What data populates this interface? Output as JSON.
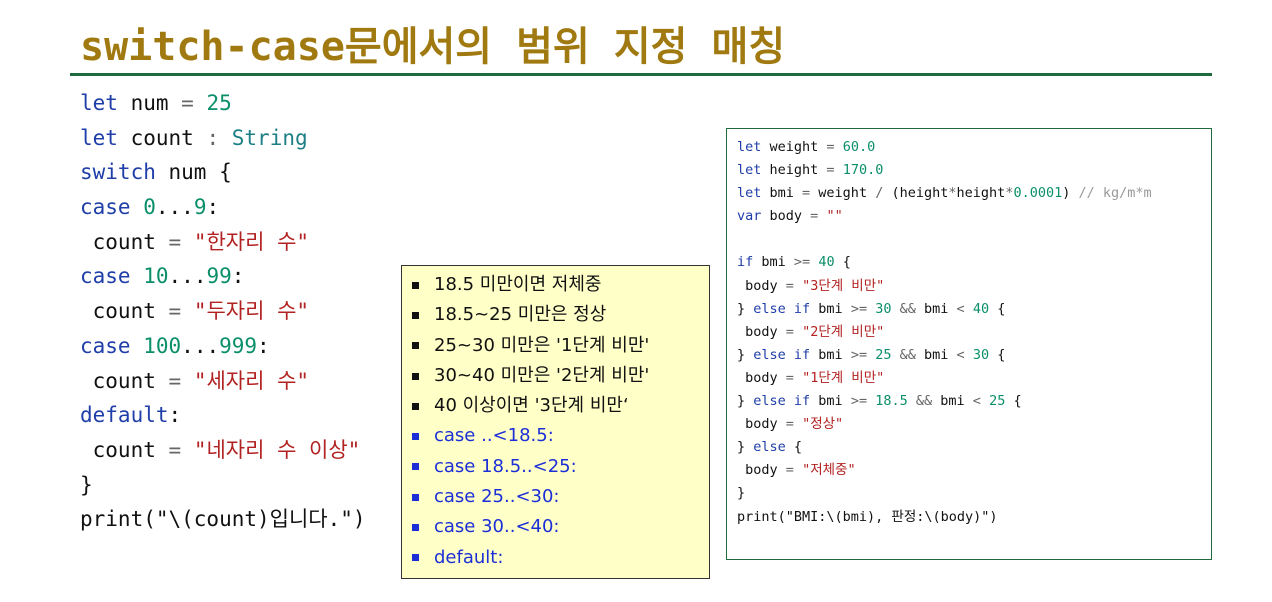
{
  "title": "switch-case문에서의 범위 지정 매칭",
  "main_code": [
    [
      {
        "t": "let",
        "c": "kw"
      },
      {
        "t": " num "
      },
      {
        "t": "=",
        "c": "op"
      },
      {
        "t": " "
      },
      {
        "t": "25",
        "c": "num"
      }
    ],
    [
      {
        "t": "let",
        "c": "kw"
      },
      {
        "t": " count "
      },
      {
        "t": ":",
        "c": "op"
      },
      {
        "t": " "
      },
      {
        "t": "String",
        "c": "type"
      }
    ],
    [
      {
        "t": "switch",
        "c": "kw"
      },
      {
        "t": " num {"
      }
    ],
    [
      {
        "t": "case",
        "c": "kw"
      },
      {
        "t": " "
      },
      {
        "t": "0",
        "c": "num"
      },
      {
        "t": "..."
      },
      {
        "t": "9",
        "c": "num"
      },
      {
        "t": ":"
      }
    ],
    [
      {
        "t": " count "
      },
      {
        "t": "=",
        "c": "op"
      },
      {
        "t": " "
      },
      {
        "t": "\"한자리 수\"",
        "c": "str"
      }
    ],
    [
      {
        "t": "case",
        "c": "kw"
      },
      {
        "t": " "
      },
      {
        "t": "10",
        "c": "num"
      },
      {
        "t": "..."
      },
      {
        "t": "99",
        "c": "num"
      },
      {
        "t": ":"
      }
    ],
    [
      {
        "t": " count "
      },
      {
        "t": "=",
        "c": "op"
      },
      {
        "t": " "
      },
      {
        "t": "\"두자리 수\"",
        "c": "str"
      }
    ],
    [
      {
        "t": "case",
        "c": "kw"
      },
      {
        "t": " "
      },
      {
        "t": "100",
        "c": "num"
      },
      {
        "t": "..."
      },
      {
        "t": "999",
        "c": "num"
      },
      {
        "t": ":"
      }
    ],
    [
      {
        "t": " count "
      },
      {
        "t": "=",
        "c": "op"
      },
      {
        "t": " "
      },
      {
        "t": "\"세자리 수\"",
        "c": "str"
      }
    ],
    [
      {
        "t": "default",
        "c": "kw"
      },
      {
        "t": ":"
      }
    ],
    [
      {
        "t": " count "
      },
      {
        "t": "=",
        "c": "op"
      },
      {
        "t": " "
      },
      {
        "t": "\"네자리 수 이상\"",
        "c": "str"
      }
    ],
    [
      {
        "t": "}"
      }
    ],
    [
      {
        "t": "print(\"\\(count)입니다.\")"
      }
    ]
  ],
  "note_items": [
    {
      "text": "18.5 미만이면 저체중",
      "color": "black"
    },
    {
      "text": "18.5~25 미만은 정상",
      "color": "black"
    },
    {
      "text": "25~30 미만은 '1단계 비만'",
      "color": "black"
    },
    {
      "text": "30~40 미만은 '2단계 비만'",
      "color": "black"
    },
    {
      "text": "40 이상이면 '3단계 비만‘",
      "color": "black"
    },
    {
      "text": "case ..<18.5:",
      "color": "blue"
    },
    {
      "text": "case 18.5..<25:",
      "color": "blue"
    },
    {
      "text": "case 25..<30:",
      "color": "blue"
    },
    {
      "text": "case 30..<40:",
      "color": "blue"
    },
    {
      "text": "default:",
      "color": "blue"
    }
  ],
  "box_code": [
    [
      {
        "t": "let",
        "c": "kw"
      },
      {
        "t": " weight "
      },
      {
        "t": "=",
        "c": "op"
      },
      {
        "t": " "
      },
      {
        "t": "60.0",
        "c": "num"
      }
    ],
    [
      {
        "t": "let",
        "c": "kw"
      },
      {
        "t": " height "
      },
      {
        "t": "=",
        "c": "op"
      },
      {
        "t": " "
      },
      {
        "t": "170.0",
        "c": "num"
      }
    ],
    [
      {
        "t": "let",
        "c": "kw"
      },
      {
        "t": " bmi "
      },
      {
        "t": "=",
        "c": "op"
      },
      {
        "t": " weight "
      },
      {
        "t": "/",
        "c": "op"
      },
      {
        "t": " (height"
      },
      {
        "t": "*",
        "c": "op"
      },
      {
        "t": "height"
      },
      {
        "t": "*",
        "c": "op"
      },
      {
        "t": "0.0001",
        "c": "num"
      },
      {
        "t": ") "
      },
      {
        "t": "// kg/m*m",
        "c": "cmt"
      }
    ],
    [
      {
        "t": "var",
        "c": "kw"
      },
      {
        "t": " body "
      },
      {
        "t": "=",
        "c": "op"
      },
      {
        "t": " "
      },
      {
        "t": "\"\"",
        "c": "str"
      }
    ],
    [
      {
        "t": ""
      }
    ],
    [
      {
        "t": "if",
        "c": "kw"
      },
      {
        "t": " bmi "
      },
      {
        "t": ">=",
        "c": "op"
      },
      {
        "t": " "
      },
      {
        "t": "40",
        "c": "num"
      },
      {
        "t": " {"
      }
    ],
    [
      {
        "t": " body "
      },
      {
        "t": "=",
        "c": "op"
      },
      {
        "t": " "
      },
      {
        "t": "\"3단계 비만\"",
        "c": "str"
      }
    ],
    [
      {
        "t": "} "
      },
      {
        "t": "else if",
        "c": "kw"
      },
      {
        "t": " bmi "
      },
      {
        "t": ">=",
        "c": "op"
      },
      {
        "t": " "
      },
      {
        "t": "30",
        "c": "num"
      },
      {
        "t": " "
      },
      {
        "t": "&&",
        "c": "op"
      },
      {
        "t": " bmi "
      },
      {
        "t": "<",
        "c": "op"
      },
      {
        "t": " "
      },
      {
        "t": "40",
        "c": "num"
      },
      {
        "t": " {"
      }
    ],
    [
      {
        "t": " body "
      },
      {
        "t": "=",
        "c": "op"
      },
      {
        "t": " "
      },
      {
        "t": "\"2단계 비만\"",
        "c": "str"
      }
    ],
    [
      {
        "t": "} "
      },
      {
        "t": "else if",
        "c": "kw"
      },
      {
        "t": " bmi "
      },
      {
        "t": ">=",
        "c": "op"
      },
      {
        "t": " "
      },
      {
        "t": "25",
        "c": "num"
      },
      {
        "t": " "
      },
      {
        "t": "&&",
        "c": "op"
      },
      {
        "t": " bmi "
      },
      {
        "t": "<",
        "c": "op"
      },
      {
        "t": " "
      },
      {
        "t": "30",
        "c": "num"
      },
      {
        "t": " {"
      }
    ],
    [
      {
        "t": " body "
      },
      {
        "t": "=",
        "c": "op"
      },
      {
        "t": " "
      },
      {
        "t": "\"1단계 비만\"",
        "c": "str"
      }
    ],
    [
      {
        "t": "} "
      },
      {
        "t": "else if",
        "c": "kw"
      },
      {
        "t": " bmi "
      },
      {
        "t": ">=",
        "c": "op"
      },
      {
        "t": " "
      },
      {
        "t": "18.5",
        "c": "num"
      },
      {
        "t": " "
      },
      {
        "t": "&&",
        "c": "op"
      },
      {
        "t": " bmi "
      },
      {
        "t": "<",
        "c": "op"
      },
      {
        "t": " "
      },
      {
        "t": "25",
        "c": "num"
      },
      {
        "t": " {"
      }
    ],
    [
      {
        "t": " body "
      },
      {
        "t": "=",
        "c": "op"
      },
      {
        "t": " "
      },
      {
        "t": "\"정상\"",
        "c": "str"
      }
    ],
    [
      {
        "t": "} "
      },
      {
        "t": "else",
        "c": "kw"
      },
      {
        "t": " {"
      }
    ],
    [
      {
        "t": " body "
      },
      {
        "t": "=",
        "c": "op"
      },
      {
        "t": " "
      },
      {
        "t": "\"저체중\"",
        "c": "str"
      }
    ],
    [
      {
        "t": "}"
      }
    ],
    [
      {
        "t": "print(\"BMI:\\(bmi), 판정:\\(body)\")"
      }
    ]
  ],
  "colors": {
    "title": "#a07a10",
    "rule": "#1f6b3e",
    "keyword": "#1f3ea8",
    "number": "#0b8f6a",
    "string": "#b22222",
    "note_bg": "#ffffc8",
    "note_blue": "#1c2fd6"
  }
}
